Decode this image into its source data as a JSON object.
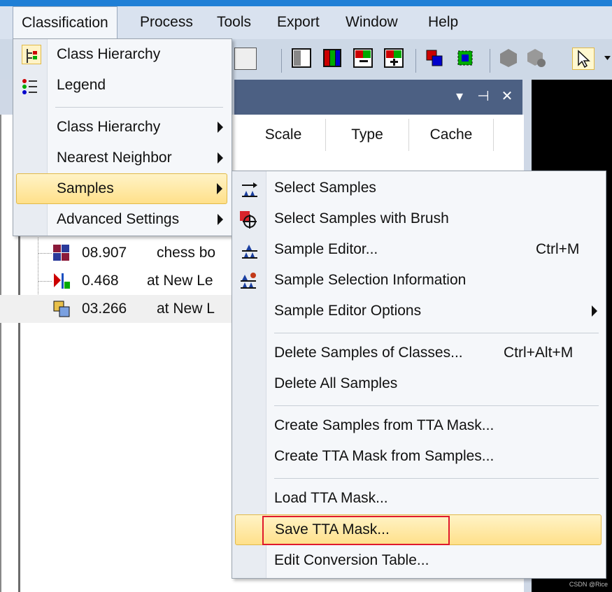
{
  "menubar": {
    "items": [
      "Classification",
      "Process",
      "Tools",
      "Export",
      "Window",
      "Help"
    ]
  },
  "panel": {
    "controls": [
      "▾",
      "⊣",
      "✕"
    ],
    "columns": [
      "Scale",
      "Type",
      "Cache"
    ]
  },
  "tree": {
    "rows": [
      {
        "value": "08.907",
        "name": "chess bo"
      },
      {
        "value": "0.468",
        "name": "at  New Le"
      },
      {
        "value": "03.266",
        "name": "at  New L"
      }
    ]
  },
  "classification_menu": {
    "items": [
      {
        "label": "Class Hierarchy",
        "icon": "class-hierarchy-icon",
        "submenu": false
      },
      {
        "label": "Legend",
        "icon": "legend-icon",
        "submenu": false
      },
      {
        "label": "Class Hierarchy",
        "submenu": true
      },
      {
        "label": "Nearest Neighbor",
        "submenu": true
      },
      {
        "label": "Samples",
        "submenu": true,
        "highlighted": true
      },
      {
        "label": "Advanced Settings",
        "submenu": true
      }
    ]
  },
  "samples_menu": {
    "items": [
      {
        "label": "Select Samples",
        "shortcut": ""
      },
      {
        "label": "Select Samples with Brush",
        "shortcut": ""
      },
      {
        "label": "Sample Editor...",
        "shortcut": "Ctrl+M"
      },
      {
        "label": "Sample Selection Information",
        "shortcut": ""
      },
      {
        "label": "Sample Editor Options",
        "shortcut": "",
        "submenu": true
      },
      {
        "label": "Delete Samples of Classes...",
        "shortcut": "Ctrl+Alt+M"
      },
      {
        "label": "Delete All Samples",
        "shortcut": ""
      },
      {
        "label": "Create Samples from TTA Mask...",
        "shortcut": ""
      },
      {
        "label": "Create TTA Mask from Samples...",
        "shortcut": ""
      },
      {
        "label": "Load TTA Mask...",
        "shortcut": ""
      },
      {
        "label": "Save TTA Mask...",
        "shortcut": "",
        "highlighted": true
      },
      {
        "label": "Edit Conversion Table...",
        "shortcut": ""
      }
    ]
  },
  "watermark": "CSDN @Rice",
  "colors": {
    "menubar": "#d9e2ef",
    "panel_header": "#4c6083",
    "highlight": "#ffe08a",
    "annotation_box": "#e0192b"
  }
}
